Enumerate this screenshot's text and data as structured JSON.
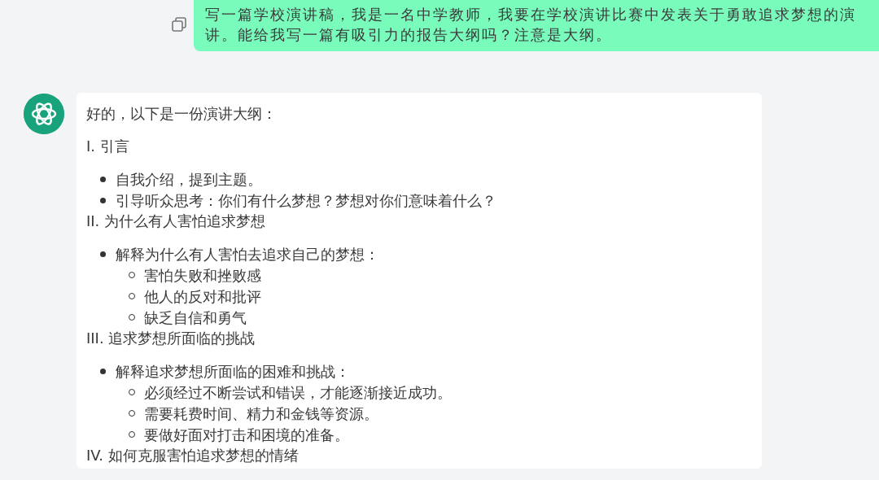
{
  "user_message": {
    "text": "写一篇学校演讲稿，我是一名中学教师，我要在学校演讲比赛中发表关于勇敢追求梦想的演讲。能给我写一篇有吸引力的报告大纲吗？注意是大纲。"
  },
  "assistant_message": {
    "intro": "好的，以下是一份演讲大纲：",
    "sections": [
      {
        "heading": "I. 引言",
        "items": [
          {
            "text": "自我介绍，提到主题。"
          },
          {
            "text": "引导听众思考：你们有什么梦想？梦想对你们意味着什么？"
          }
        ]
      },
      {
        "heading": "II. 为什么有人害怕追求梦想",
        "items": [
          {
            "text": "解释为什么有人害怕去追求自己的梦想：",
            "children": [
              {
                "text": "害怕失败和挫败感"
              },
              {
                "text": "他人的反对和批评"
              },
              {
                "text": "缺乏自信和勇气"
              }
            ]
          }
        ]
      },
      {
        "heading": "III. 追求梦想所面临的挑战",
        "items": [
          {
            "text": "解释追求梦想所面临的困难和挑战：",
            "children": [
              {
                "text": "必须经过不断尝试和错误，才能逐渐接近成功。"
              },
              {
                "text": "需要耗费时间、精力和金钱等资源。"
              },
              {
                "text": "要做好面对打击和困境的准备。"
              }
            ]
          }
        ]
      },
      {
        "heading": "IV. 如何克服害怕追求梦想的情绪"
      }
    ]
  }
}
